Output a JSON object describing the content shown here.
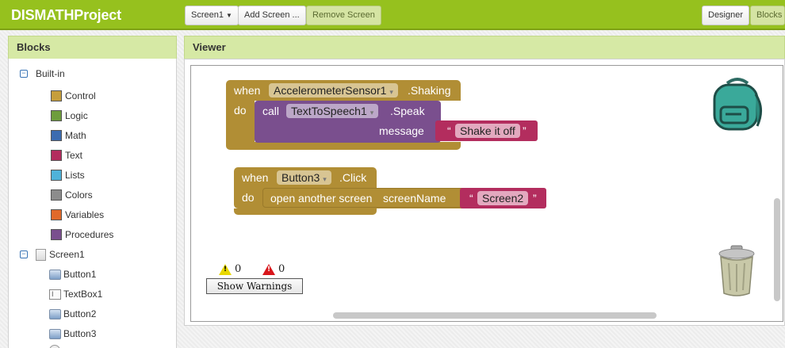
{
  "header": {
    "project_title": "DISMATHProject",
    "screen_select": "Screen1",
    "add_screen": "Add Screen ...",
    "remove_screen": "Remove Screen",
    "designer": "Designer",
    "blocks": "Blocks"
  },
  "blocks_panel": {
    "title": "Blocks",
    "builtin_label": "Built-in",
    "builtin_items": [
      {
        "label": "Control",
        "color": "#c69e3c"
      },
      {
        "label": "Logic",
        "color": "#6e9d3c"
      },
      {
        "label": "Math",
        "color": "#3c6cb0"
      },
      {
        "label": "Text",
        "color": "#b32d5e"
      },
      {
        "label": "Lists",
        "color": "#4fb2d9"
      },
      {
        "label": "Colors",
        "color": "#8c8c8c"
      },
      {
        "label": "Variables",
        "color": "#e0692a"
      },
      {
        "label": "Procedures",
        "color": "#7a4f8e"
      }
    ],
    "screen_label": "Screen1",
    "components": [
      "Button1",
      "TextBox1",
      "Button2",
      "Button3"
    ]
  },
  "viewer": {
    "title": "Viewer",
    "block1": {
      "when": "when",
      "component": "AccelerometerSensor1",
      "event": ".Shaking",
      "do": "do",
      "call": "call",
      "call_component": "TextToSpeech1",
      "method": ".Speak",
      "arg_label": "message",
      "text_value": "Shake it off",
      "quote_open": "“",
      "quote_close": "”"
    },
    "block2": {
      "when": "when",
      "component": "Button3",
      "event": ".Click",
      "do": "do",
      "action": "open another screen",
      "arg_label": "screenName",
      "text_value": "Screen2",
      "quote_open": "“",
      "quote_close": "”"
    },
    "warnings_count": "0",
    "errors_count": "0",
    "show_warnings": "Show Warnings"
  }
}
